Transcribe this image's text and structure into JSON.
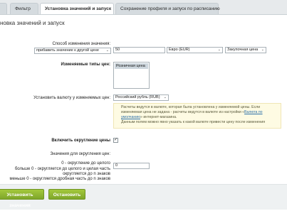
{
  "tabs": [
    "",
    "Фильтр",
    "Установка значений и запуск",
    "Сохранение профиля и запуск по расписанию"
  ],
  "title": "новка значений и запуск",
  "change_mode": {
    "label": "Способ изменения значения:",
    "value": "прибавить значение к другой цене",
    "amount": "50",
    "currency": "Евро (EUR)",
    "price_type": "Закупочная цена"
  },
  "types": {
    "label": "Изменяемые типы цен:",
    "options": [
      "Розничная цена"
    ]
  },
  "set_currency": {
    "label": "Установить валюту у изменяемых цен:",
    "value": "Российский рубль (RUB)"
  },
  "note": {
    "line1": "Расчеты ведутся в валюте, которая была установлена у изменяемой цены. Если",
    "line2": "изменяемая цена не задана - расчеты ведутся в валюте из настройки «",
    "link": "Валюта по умолчанию",
    "line3": "» интернет-магазина.",
    "line4": "Данным полем можно явно указать к какой валюте привести цену после изменения"
  },
  "rounding": {
    "label": "Включить округление цены",
    "checked": "✓",
    "values_label": "Значения для округления цен:",
    "rule1": "0 - округление до целого",
    "rule2": "больше 0 - округляется до целого и целая часть",
    "rule3": "округляется до n знаков",
    "rule4": "меньше 0 - округляется дробная часть до n знаков",
    "value": "0"
  },
  "buttons": {
    "apply": "Установить значения",
    "stop": "Остановить"
  },
  "arrow": "⌄",
  "colors": {
    "button_green": "#8bb12f",
    "note_bg": "#fefbe3",
    "link": "#2b6fa8"
  }
}
